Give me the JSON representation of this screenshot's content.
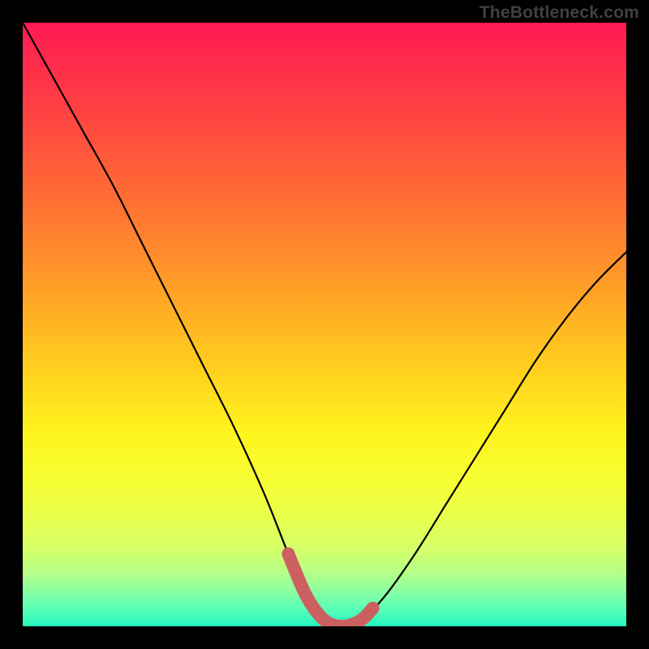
{
  "watermark": "TheBottleneck.com",
  "colors": {
    "curve": "#000000",
    "highlight": "#cc6061",
    "frame_bg": "#000000"
  },
  "chart_data": {
    "type": "line",
    "title": "",
    "xlabel": "",
    "ylabel": "",
    "xlim": [
      0,
      100
    ],
    "ylim": [
      0,
      100
    ],
    "grid": false,
    "series": [
      {
        "name": "bottleneck-curve",
        "x": [
          0,
          5,
          10,
          15,
          20,
          25,
          30,
          35,
          40,
          44,
          47,
          50,
          53,
          56,
          60,
          65,
          70,
          75,
          80,
          85,
          90,
          95,
          100
        ],
        "y": [
          100,
          91,
          82,
          73,
          63,
          53,
          43,
          33,
          22,
          12,
          5,
          1,
          0,
          1,
          5,
          12,
          20,
          28,
          36,
          44,
          51,
          57,
          62
        ]
      }
    ],
    "highlight_segment": {
      "x_range": [
        44,
        58
      ],
      "description": "thick salmon segment near curve minimum"
    },
    "gradient_stops": [
      {
        "pos": 0.0,
        "color": "#ff1a52"
      },
      {
        "pos": 0.4,
        "color": "#ff8a2c"
      },
      {
        "pos": 0.68,
        "color": "#fff41e"
      },
      {
        "pos": 1.0,
        "color": "#26f7be"
      }
    ]
  }
}
